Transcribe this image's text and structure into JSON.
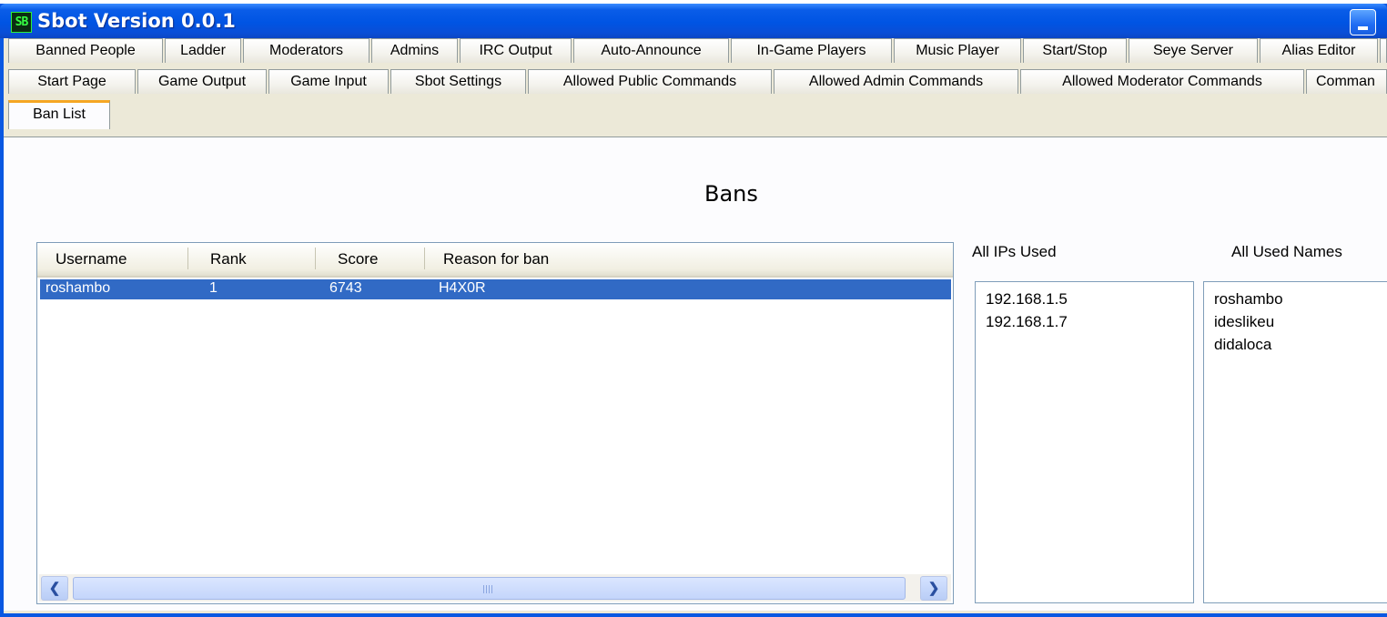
{
  "window": {
    "title": "Sbot Version 0.0.1",
    "icon_text": "SB",
    "accent": "#0054e3"
  },
  "tabs_row1": [
    "Banned People",
    "Ladder",
    "Moderators",
    "Admins",
    "IRC Output",
    "Auto-Announce",
    "In-Game Players",
    "Music Player",
    "Start/Stop",
    "Seye Server",
    "Alias Editor"
  ],
  "tabs_row2": [
    "Start Page",
    "Game Output",
    "Game Input",
    "Sbot Settings",
    "Allowed Public Commands",
    "Allowed Admin Commands",
    "Allowed Moderator Commands",
    "Comman"
  ],
  "tabs_row3": [
    "Ban List"
  ],
  "selected_tab": "Ban List",
  "page": {
    "title": "Bans"
  },
  "bans_table": {
    "columns": [
      "Username",
      "Rank",
      "Score",
      "Reason for ban"
    ],
    "rows": [
      {
        "username": "roshambo",
        "rank": "1",
        "score": "6743",
        "reason": "H4X0R",
        "selected": true
      }
    ]
  },
  "ips": {
    "label": "All IPs Used",
    "items": [
      "192.168.1.5",
      "192.168.1.7"
    ]
  },
  "names": {
    "label": "All Used Names",
    "items": [
      "roshambo",
      "ideslikeu",
      "didaloca"
    ]
  },
  "colors": {
    "selection": "#316ac5",
    "tab_highlight": "#f5a623"
  }
}
